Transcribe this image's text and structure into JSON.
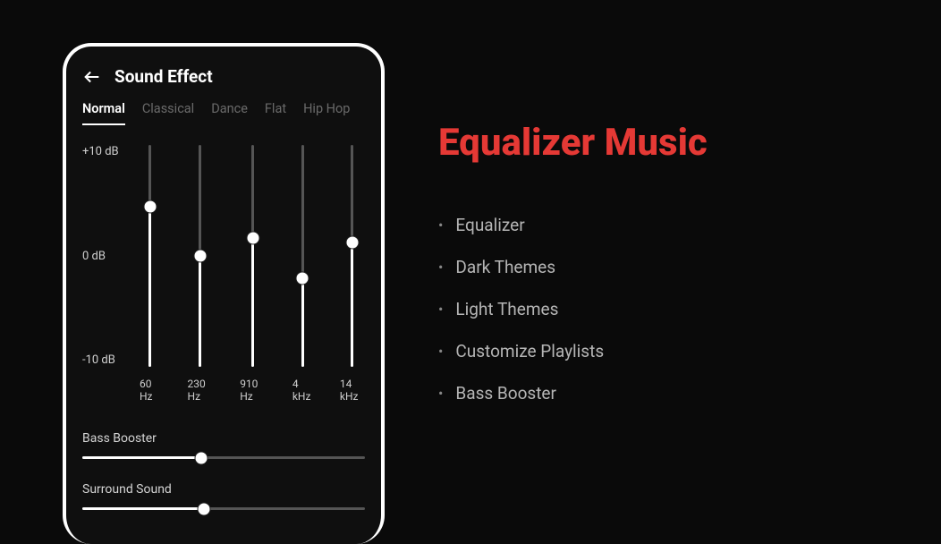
{
  "header": {
    "title": "Sound Effect"
  },
  "tabs": {
    "items": [
      {
        "label": "Normal",
        "active": true
      },
      {
        "label": "Classical",
        "active": false
      },
      {
        "label": "Dance",
        "active": false
      },
      {
        "label": "Flat",
        "active": false
      },
      {
        "label": "Hip Hop",
        "active": false
      }
    ]
  },
  "eq": {
    "db_labels": {
      "top": "+10 dB",
      "mid": "0 dB",
      "bottom": "-10 dB"
    },
    "bands": [
      {
        "freq": "60 Hz",
        "pos": 72
      },
      {
        "freq": "230 Hz",
        "pos": 50
      },
      {
        "freq": "910 Hz",
        "pos": 58
      },
      {
        "freq": "4 kHz",
        "pos": 40
      },
      {
        "freq": "14 kHz",
        "pos": 56
      }
    ]
  },
  "controls": {
    "bass": {
      "label": "Bass Booster",
      "value": 42
    },
    "surround": {
      "label": "Surround Sound",
      "value": 43
    }
  },
  "marketing": {
    "headline": "Equalizer Music",
    "features": [
      "Equalizer",
      "Dark Themes",
      "Light Themes",
      "Customize Playlists",
      "Bass Booster"
    ]
  },
  "chart_data": {
    "type": "bar",
    "title": "Equalizer Bands",
    "categories": [
      "60 Hz",
      "230 Hz",
      "910 Hz",
      "4 kHz",
      "14 kHz"
    ],
    "values_db": [
      4.4,
      0.0,
      1.6,
      -2.0,
      1.2
    ],
    "ylabel": "dB",
    "ylim": [
      -10,
      10
    ]
  }
}
